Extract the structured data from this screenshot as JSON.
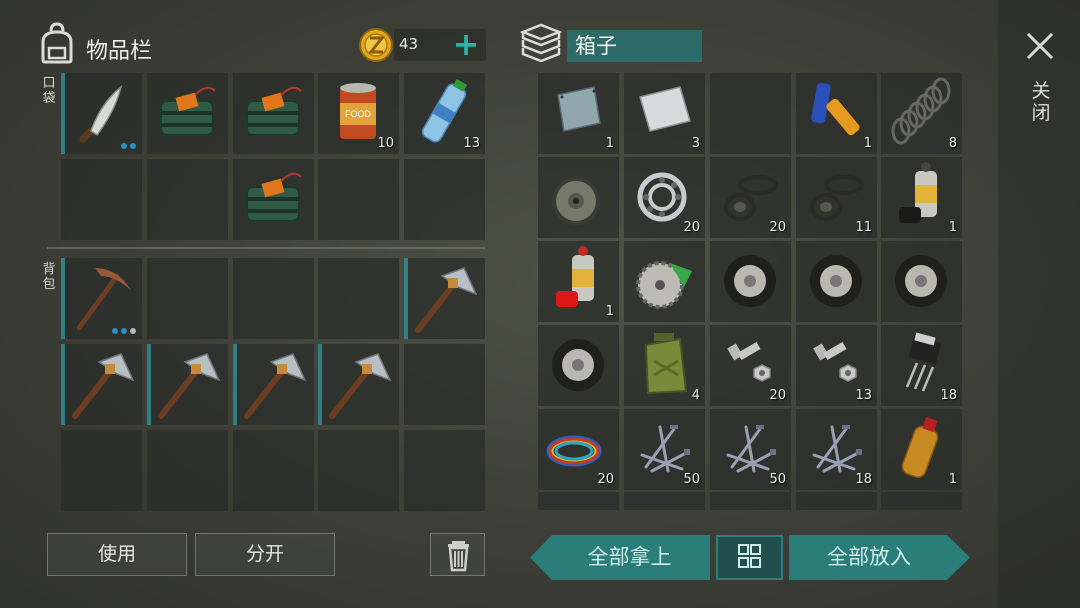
{
  "inventory": {
    "title": "物品栏",
    "gold": "43",
    "pocket_label": "口袋",
    "backpack_label": "背包",
    "pocket": [
      {
        "item": "machete",
        "qty": "",
        "dots": [
          "on",
          "on"
        ]
      },
      {
        "item": "explosive",
        "qty": ""
      },
      {
        "item": "explosive",
        "qty": ""
      },
      {
        "item": "food-can",
        "qty": "10",
        "label": "FOOD"
      },
      {
        "item": "water-bottle",
        "qty": "13"
      },
      {
        "item": "",
        "qty": ""
      },
      {
        "item": "",
        "qty": ""
      },
      {
        "item": "explosive",
        "qty": ""
      },
      {
        "item": "",
        "qty": ""
      },
      {
        "item": "",
        "qty": ""
      }
    ],
    "backpack": [
      {
        "item": "pickaxe",
        "qty": "",
        "dots": [
          "on",
          "on",
          "off"
        ]
      },
      {
        "item": "",
        "qty": ""
      },
      {
        "item": "",
        "qty": ""
      },
      {
        "item": "",
        "qty": ""
      },
      {
        "item": "pick-hammer",
        "qty": ""
      },
      {
        "item": "pick-hammer",
        "qty": ""
      },
      {
        "item": "pick-hammer",
        "qty": ""
      },
      {
        "item": "pick-hammer",
        "qty": ""
      },
      {
        "item": "pick-hammer",
        "qty": ""
      },
      {
        "item": "",
        "qty": ""
      },
      {
        "item": "",
        "qty": ""
      },
      {
        "item": "",
        "qty": ""
      },
      {
        "item": "",
        "qty": ""
      },
      {
        "item": "",
        "qty": ""
      },
      {
        "item": "",
        "qty": ""
      }
    ],
    "use_label": "使用",
    "split_label": "分开"
  },
  "box": {
    "title": "箱子",
    "close_label": "关闭",
    "take_all_label": "全部拿上",
    "put_all_label": "全部放入",
    "items": [
      {
        "item": "metal-plate",
        "qty": "1"
      },
      {
        "item": "steel-sheet",
        "qty": "3"
      },
      {
        "item": "",
        "qty": ""
      },
      {
        "item": "batteries",
        "qty": "1"
      },
      {
        "item": "spring",
        "qty": "8"
      },
      {
        "item": "brake-disc",
        "qty": ""
      },
      {
        "item": "bearing",
        "qty": "20"
      },
      {
        "item": "seals",
        "qty": "20"
      },
      {
        "item": "seals",
        "qty": "11"
      },
      {
        "item": "spray-black",
        "qty": "1",
        "label": "Armo"
      },
      {
        "item": "spray-red",
        "qty": "1",
        "label": "Armo"
      },
      {
        "item": "saw-blade",
        "qty": ""
      },
      {
        "item": "wheel",
        "qty": ""
      },
      {
        "item": "wheel",
        "qty": ""
      },
      {
        "item": "wheel",
        "qty": ""
      },
      {
        "item": "wheel",
        "qty": ""
      },
      {
        "item": "jerrycan",
        "qty": "4"
      },
      {
        "item": "bolts",
        "qty": "20"
      },
      {
        "item": "bolts",
        "qty": "13"
      },
      {
        "item": "transistor",
        "qty": "18"
      },
      {
        "item": "wires",
        "qty": "20"
      },
      {
        "item": "nails",
        "qty": "50"
      },
      {
        "item": "nails",
        "qty": "50"
      },
      {
        "item": "nails",
        "qty": "18"
      },
      {
        "item": "fuel-bottle",
        "qty": "1"
      }
    ]
  },
  "colors": {
    "accent": "#2a7d79",
    "coin": "#e0a81a",
    "plus": "#2bb3a6"
  },
  "icons": {
    "backpack": "backpack-icon",
    "box": "stack-box-icon",
    "coin": "z-coin-icon",
    "close": "close-icon",
    "trash": "trash-icon",
    "grid": "grid-icon"
  }
}
